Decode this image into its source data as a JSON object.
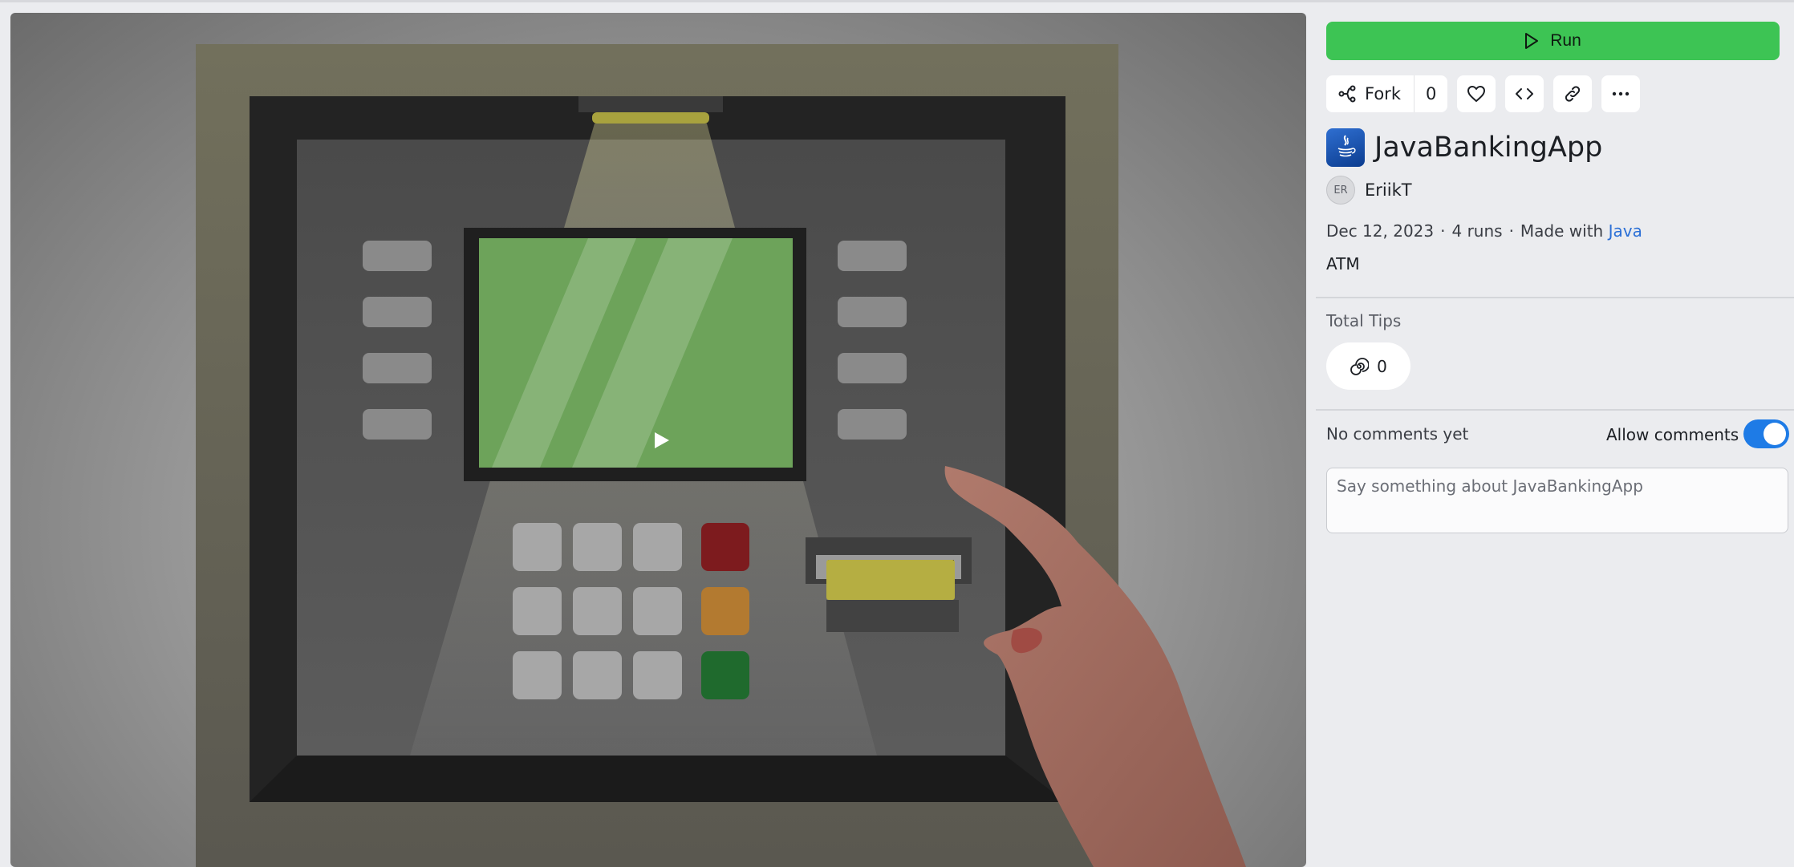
{
  "preview": {
    "play_icon": "play-icon"
  },
  "sidebar": {
    "run_label": "Run",
    "fork_label": "Fork",
    "fork_count": "0",
    "icons": [
      "fork-icon",
      "heart-icon",
      "code-icon",
      "link-icon",
      "more-icon"
    ],
    "app_icon": "java-icon",
    "title": "JavaBankingApp",
    "author_initials": "ER",
    "author": "EriikT",
    "date": "Dec 12, 2023",
    "runs": "4 runs",
    "made_with": "Made with",
    "language": "Java",
    "separator": "·",
    "description": "ATM",
    "tips_label": "Total Tips",
    "tips_count": "0",
    "comments_status": "No comments yet",
    "allow_comments_label": "Allow comments",
    "allow_comments": true,
    "comment_placeholder": "Say something about JavaBankingApp",
    "colors": {
      "run": "#3dc454",
      "toggle": "#1e7be6",
      "link": "#2a6fd6",
      "background": "#ebecef"
    }
  }
}
